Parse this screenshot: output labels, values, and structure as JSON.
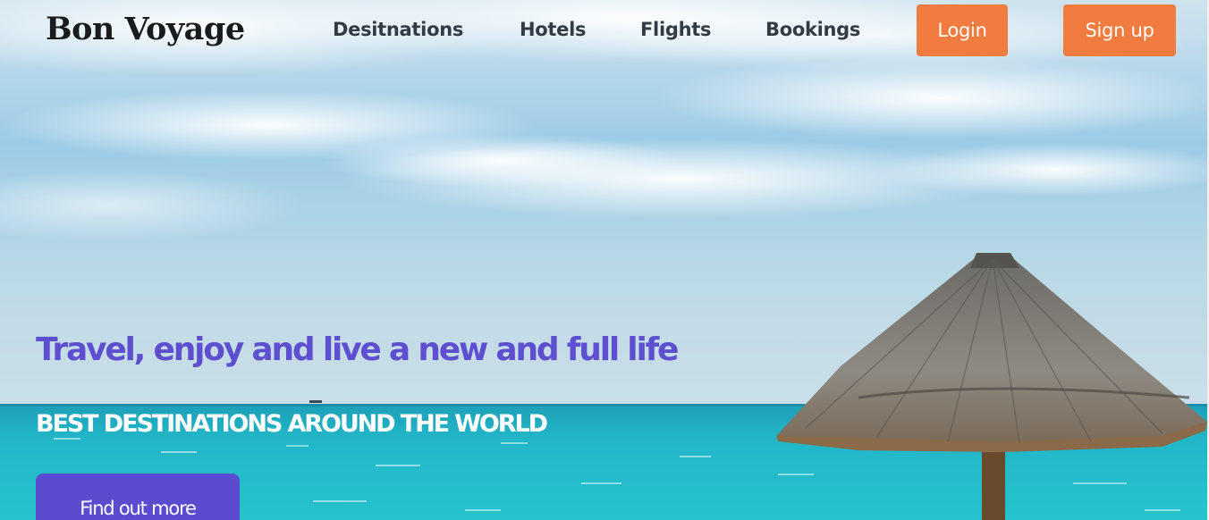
{
  "brand": {
    "logo_text": "Bon Voyage"
  },
  "nav": {
    "links": [
      "Desitnations",
      "Hotels",
      "Flights",
      "Bookings"
    ],
    "login_label": "Login",
    "signup_label": "Sign up"
  },
  "hero": {
    "tagline": "Travel, enjoy and live a new and full life",
    "subheading": "BEST DESTINATIONS AROUND THE WORLD",
    "cta_label": "Find out more",
    "background": "beach-palapa-umbrella-photo"
  },
  "colors": {
    "accent_orange": "#f27b40",
    "accent_purple": "#5e4fd0",
    "nav_text": "#333b45",
    "logo_text": "#1b1b1b"
  }
}
